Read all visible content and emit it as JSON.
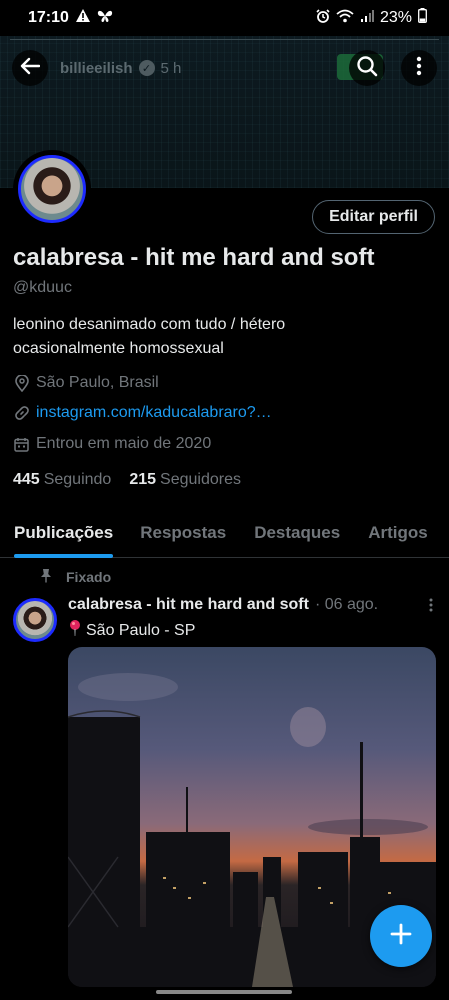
{
  "status_bar": {
    "time": "17:10",
    "battery": "23%",
    "icons": [
      "warning-icon",
      "butterfly-icon",
      "alarm-icon",
      "wifi-icon",
      "signal-icon",
      "battery-icon"
    ]
  },
  "topbar": {
    "account": "billieeilish",
    "time": "5 h",
    "icons": [
      "back-arrow-icon",
      "verified-badge-icon",
      "search-icon",
      "more-vertical-icon"
    ]
  },
  "profile": {
    "edit_label": "Editar perfil",
    "display_name": "calabresa - hit me hard and soft",
    "handle": "@kduuc",
    "bio": "leonino desanimado com tudo /  hétero\nocasionalmente homossexual",
    "location": "São Paulo, Brasil",
    "link": "instagram.com/kaducalabraro?…",
    "joined": "Entrou em maio de 2020",
    "following_count": "445",
    "following_label": "Seguindo",
    "followers_count": "215",
    "followers_label": "Seguidores"
  },
  "tabs": [
    {
      "label": "Publicações",
      "active": true
    },
    {
      "label": "Respostas",
      "active": false
    },
    {
      "label": "Destaques",
      "active": false
    },
    {
      "label": "Artigos",
      "active": false
    }
  ],
  "pinned_post": {
    "pinned_label": "Fixado",
    "author": "calabresa - hit me hard and soft",
    "date": "· 06 ago.",
    "text": "São Paulo - SP",
    "text_icon": "round-pushpin-icon"
  },
  "colors": {
    "accent": "#1d9bf0",
    "avatar_ring": "#1d2bff",
    "muted": "#71767b"
  }
}
